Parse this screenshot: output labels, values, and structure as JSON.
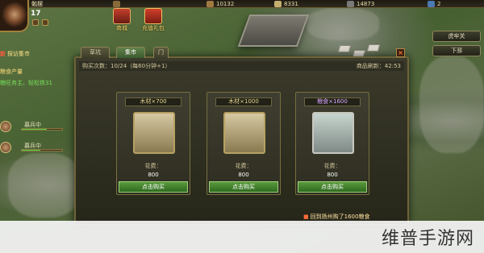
{
  "player": {
    "name": "勉摆",
    "level": "17"
  },
  "resources": [
    "",
    "10132",
    "8331",
    "14873",
    "2"
  ],
  "top_icons": [
    {
      "label": "商城"
    },
    {
      "label": "充值礼包"
    }
  ],
  "left_panel": {
    "quest_tag": "新",
    "quest_text": "探访集市",
    "food_label": "粮食产量",
    "food_text": "粮旺务主、轻松铁31",
    "slots": [
      {
        "name": "募兵中",
        "progress": 0.62
      },
      {
        "name": "募兵中",
        "progress": 0.45
      }
    ]
  },
  "right_buttons": [
    "虎牢关",
    "下邳"
  ],
  "dialog": {
    "tabs": [
      "草坑",
      "集市",
      "门"
    ],
    "active_tab": 1,
    "close_glyph": "×",
    "buy_count_text": "购买次数：10/24（每60分钟+1）",
    "refresh_text": "商品刷新：42:53",
    "cards": [
      {
        "name": "木材×700",
        "cost_label": "花费：",
        "price": "800",
        "buy_label": "点击购买",
        "item_icon": "wood-icon"
      },
      {
        "name": "木材×1000",
        "cost_label": "花费：",
        "price": "800",
        "buy_label": "点击购买",
        "item_icon": "wood-icon"
      },
      {
        "name": "粮食×1600",
        "cost_label": "花费：",
        "price": "800",
        "buy_label": "点击购买",
        "item_icon": "rice-bag-icon"
      }
    ],
    "notice_tag": "■",
    "notice_text": "回到扬州购了1600粮食"
  },
  "watermark": "维普手游网",
  "colors": {
    "accent_green": "#4f8a32",
    "gold": "#e8d890",
    "purple": "#d7a7ff"
  }
}
